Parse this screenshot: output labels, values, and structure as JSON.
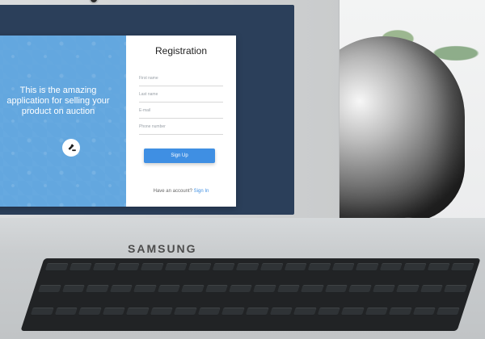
{
  "hero": {
    "headline": "This is the amazing application for selling your product on auction"
  },
  "registration": {
    "title": "Registration",
    "fields": {
      "first_name": {
        "placeholder": "First name",
        "value": ""
      },
      "last_name": {
        "placeholder": "Last name",
        "value": ""
      },
      "email": {
        "placeholder": "E-mail",
        "value": ""
      },
      "phone": {
        "placeholder": "Phone number",
        "value": ""
      }
    },
    "submit_label": "Sign Up",
    "account_prompt": "Have an account?",
    "signin_link": "Sign In"
  },
  "device": {
    "brand": "SAMSUNG"
  },
  "colors": {
    "screen_bg": "#2b3f5a",
    "hero_bg": "#63a7df",
    "primary": "#3f8fe3"
  },
  "icons": {
    "hero_badge": "gavel-icon"
  }
}
